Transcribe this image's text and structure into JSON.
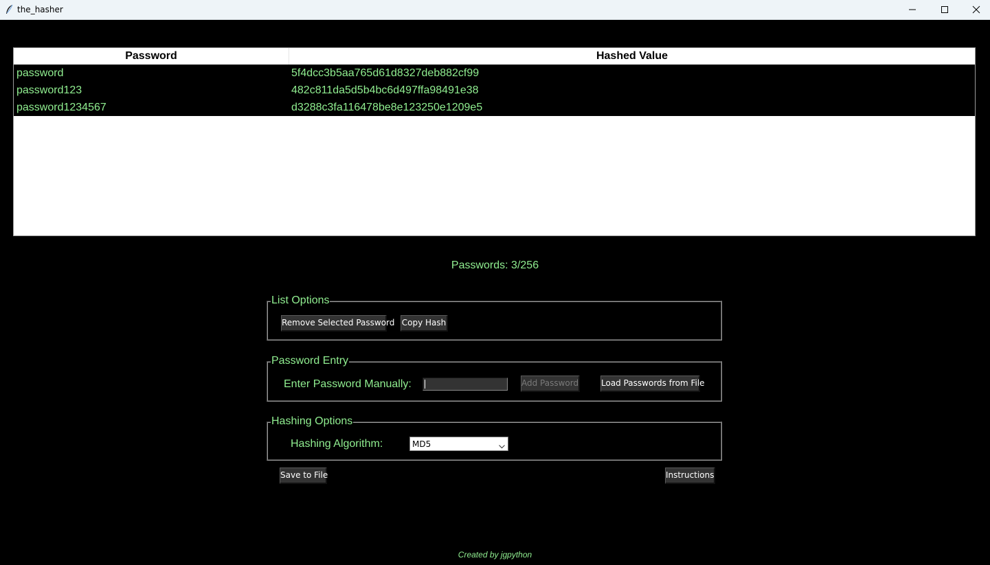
{
  "window": {
    "title": "the_hasher",
    "icons": [
      "feather-icon",
      "minimize-icon",
      "maximize-icon",
      "close-icon"
    ]
  },
  "table": {
    "columns": [
      "Password",
      "Hashed Value"
    ],
    "rows": [
      {
        "password": "password",
        "hash": "5f4dcc3b5aa765d61d8327deb882cf99"
      },
      {
        "password": "password123",
        "hash": "482c811da5d5b4bc6d497ffa98491e38"
      },
      {
        "password": "password1234567",
        "hash": "d3288c3fa116478be8e123250e1209e5"
      }
    ]
  },
  "counter": "Passwords: 3/256",
  "list_options": {
    "title": "List Options",
    "remove_label": "Remove Selected Password",
    "copy_label": "Copy Hash"
  },
  "password_entry": {
    "title": "Password Entry",
    "manual_label": "Enter Password Manually:",
    "input_value": "",
    "add_label": "Add Password",
    "load_label": "Load Passwords from File"
  },
  "hashing_options": {
    "title": "Hashing Options",
    "algorithm_label": "Hashing Algorithm:",
    "algorithm_value": "MD5"
  },
  "actions": {
    "save_label": "Save to File",
    "instructions_label": "Instructions"
  },
  "footer": "Created by jgpython",
  "colors": {
    "background": "#000000",
    "accent_text": "#90ee90",
    "button_bg": "#333333"
  }
}
